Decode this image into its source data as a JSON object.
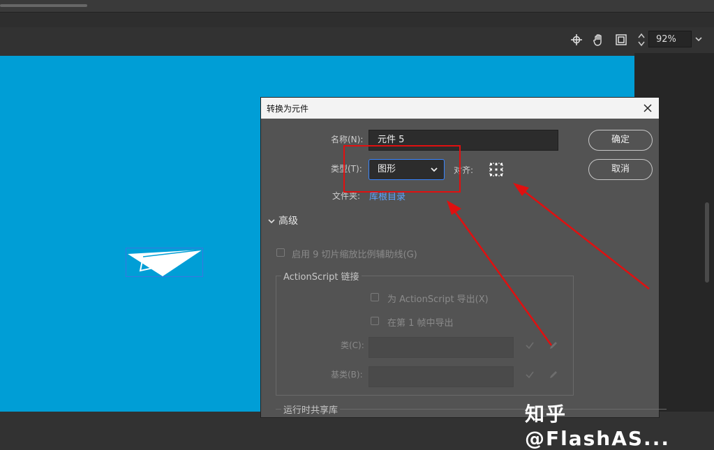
{
  "toolbar": {
    "zoom_value": "92%"
  },
  "dialog": {
    "title": "转换为元件",
    "name_label": "名称(N):",
    "name_value": "元件 5",
    "type_label": "类型(T):",
    "type_value": "图形",
    "align_label": "对齐:",
    "folder_label": "文件夹:",
    "folder_value": "库根目录",
    "ok_label": "确定",
    "cancel_label": "取消",
    "advanced_label": "高级",
    "nine_slice_label": "启用 9 切片缩放比例辅助线(G)",
    "actionscript_group_label": "ActionScript 链接",
    "export_as_label": "为 ActionScript 导出(X)",
    "export_frame_label": "在第 1 帧中导出",
    "class_label": "类(C):",
    "base_class_label": "基类(B):",
    "runtime_shared_label": "运行时共享库"
  },
  "watermark": {
    "text": "知乎 @FlashAS..."
  },
  "colors": {
    "stage": "#009ed6",
    "annotation": "#e01010",
    "link": "#5ea3ff"
  }
}
